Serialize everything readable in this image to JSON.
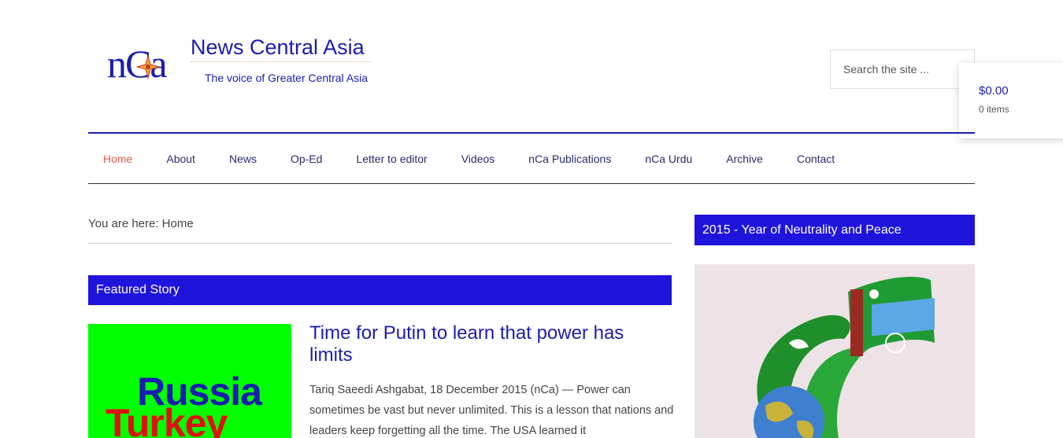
{
  "site": {
    "logo_mark": "nCa",
    "title": "News Central Asia",
    "tagline": "The voice of Greater Central Asia"
  },
  "search": {
    "placeholder": "Search the site ..."
  },
  "cart": {
    "amount": "$0.00",
    "items": "0 items"
  },
  "nav": {
    "items": [
      {
        "label": "Home",
        "active": true
      },
      {
        "label": "About"
      },
      {
        "label": "News"
      },
      {
        "label": "Op-Ed"
      },
      {
        "label": "Letter to editor"
      },
      {
        "label": "Videos"
      },
      {
        "label": "nCa Publications"
      },
      {
        "label": "nCa Urdu"
      },
      {
        "label": "Archive"
      },
      {
        "label": "Contact"
      }
    ]
  },
  "breadcrumb": "You are here: Home",
  "featured": {
    "section_title": "Featured Story",
    "image_words": [
      "Russia",
      "Turkey"
    ],
    "title": "Time for Putin to learn that power has limits",
    "excerpt": "Tariq Saeedi Ashgabat, 18 December 2015 (nCa) — Power can sometimes be vast but never unlimited. This is a lesson that nations and leaders keep forgetting all the time. The USA learned it"
  },
  "sidebar": {
    "widget_title": "2015 - Year of Neutrality and Peace"
  },
  "colors": {
    "brand_blue": "#1c1cb0",
    "bar_blue": "#1f14dc",
    "active_nav": "#e05a4a"
  }
}
